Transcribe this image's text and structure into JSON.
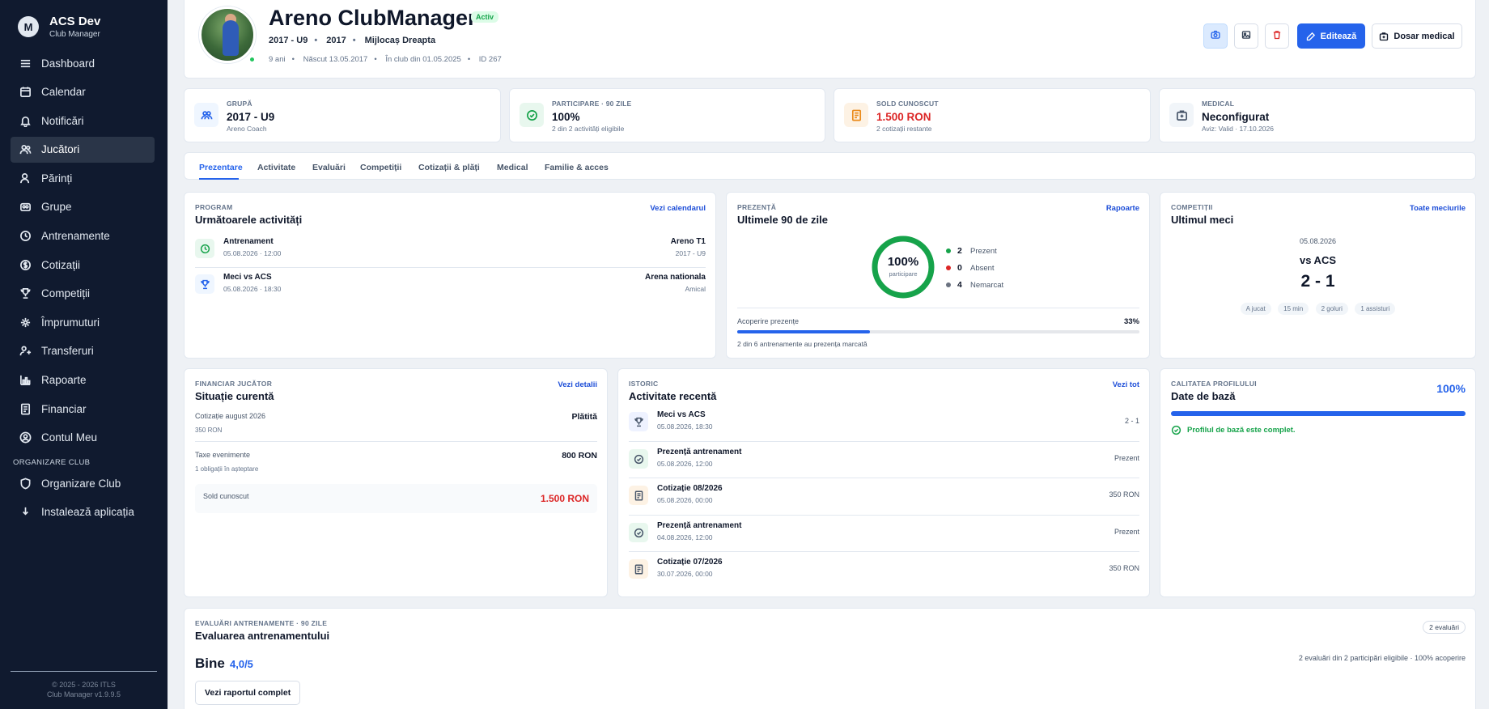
{
  "brand": {
    "title": "ACS Dev",
    "subtitle": "Club Manager",
    "logo_letter": "M"
  },
  "sidebar": {
    "items": [
      {
        "label": "Dashboard",
        "icon": "home-icon"
      },
      {
        "label": "Calendar",
        "icon": "calendar-icon"
      },
      {
        "label": "Notificări",
        "icon": "bell-icon"
      },
      {
        "label": "Jucători",
        "icon": "users-icon",
        "active": true
      },
      {
        "label": "Părinți",
        "icon": "user-icon"
      },
      {
        "label": "Grupe",
        "icon": "group-icon"
      },
      {
        "label": "Antrenamente",
        "icon": "whistle-icon"
      },
      {
        "label": "Cotizații",
        "icon": "dollar-icon"
      },
      {
        "label": "Competiții",
        "icon": "trophy-icon"
      },
      {
        "label": "Împrumuturi",
        "icon": "loan-icon"
      },
      {
        "label": "Transferuri",
        "icon": "transfer-icon"
      },
      {
        "label": "Rapoarte",
        "icon": "chart-icon"
      },
      {
        "label": "Financiar",
        "icon": "receipt-icon"
      },
      {
        "label": "Contul Meu",
        "icon": "account-icon"
      }
    ],
    "section_label": "ORGANIZARE CLUB",
    "section_items": [
      {
        "label": "Organizare Club",
        "icon": "shield-icon"
      },
      {
        "label": "Instalează aplicația",
        "icon": "download-icon"
      }
    ],
    "footer_line1": "© 2025 - 2026 ITLS",
    "footer_line2": "Club Manager v1.9.9.5"
  },
  "player": {
    "name": "Areno ClubManager",
    "status": "Activ",
    "group": "2017 - U9",
    "year": "2017",
    "position": "Mijlocaș Dreapta",
    "age": "9 ani",
    "born": "Născut 13.05.2017",
    "joined": "În club din 01.05.2025",
    "id": "ID 267"
  },
  "actions": {
    "edit": "Editează",
    "medical": "Dosar medical"
  },
  "stats": [
    {
      "label": "GRUPĂ",
      "value": "2017 - U9",
      "sub": "Areno Coach",
      "icon": "group-icon"
    },
    {
      "label": "PARTICIPARE · 90 ZILE",
      "value": "100%",
      "sub": "2 din 2 activități eligibile",
      "icon": "check-circle-icon"
    },
    {
      "label": "SOLD CUNOSCUT",
      "value": "1.500 RON",
      "sub": "2 cotizații restante",
      "icon": "receipt-icon"
    },
    {
      "label": "MEDICAL",
      "value": "Neconfigurat",
      "sub": "Aviz: Valid · 17.10.2026",
      "icon": "medical-kit-icon"
    }
  ],
  "tabs": [
    "Prezentare",
    "Activitate",
    "Evaluări",
    "Competiții",
    "Cotizații & plăți",
    "Medical",
    "Familie & acces"
  ],
  "program": {
    "label": "PROGRAM",
    "title": "Următoarele activități",
    "link": "Vezi calendarul",
    "items": [
      {
        "title": "Antrenament",
        "date": "05.08.2026 · 12:00",
        "place": "Areno T1",
        "detail": "2017 - U9",
        "icon": "clock-icon"
      },
      {
        "title": "Meci vs ACS",
        "date": "05.08.2026 · 18:30",
        "place": "Arena nationala",
        "detail": "Amical",
        "icon": "trophy-icon"
      }
    ]
  },
  "attendance": {
    "label": "PREZENȚĂ",
    "title": "Ultimele 90 de zile",
    "link": "Rapoarte",
    "percent": "100%",
    "percent_value": 100,
    "percent_caption": "participare",
    "legend": [
      {
        "count": "2",
        "label": "Prezent",
        "color": "#16a34a"
      },
      {
        "count": "0",
        "label": "Absent",
        "color": "#dc2626"
      },
      {
        "count": "4",
        "label": "Nemarcat",
        "color": "#6b7280"
      }
    ],
    "coverage_label": "Acoperire prezențe",
    "coverage_value": "33%",
    "coverage_fraction": 0.33,
    "coverage_note": "2 din 6 antrenamente au prezența marcată"
  },
  "last_match": {
    "label": "COMPETIȚII",
    "title": "Ultimul meci",
    "link": "Toate meciurile",
    "date": "05.08.2026",
    "opponent": "vs ACS",
    "score": "2 - 1",
    "chips": [
      "A jucat",
      "15 min",
      "2 goluri",
      "1 assisturi"
    ]
  },
  "finance": {
    "label": "FINANCIAR JUCĂTOR",
    "title": "Situație curentă",
    "link": "Vezi detalii",
    "items": [
      {
        "name": "Cotizație august 2026",
        "sub": "350 RON",
        "value": "Plătită"
      },
      {
        "name": "Taxe evenimente",
        "sub": "1 obligații în așteptare",
        "value": "800 RON"
      }
    ],
    "balance_label": "Sold cunoscut",
    "balance_value": "1.500 RON"
  },
  "history": {
    "label": "ISTORIC",
    "title": "Activitate recentă",
    "link": "Vezi tot",
    "items": [
      {
        "title": "Meci vs ACS",
        "date": "05.08.2026, 18:30",
        "value": "2 - 1",
        "icon": "trophy-icon",
        "tone": "blue"
      },
      {
        "title": "Prezență antrenament",
        "date": "05.08.2026, 12:00",
        "value": "Prezent",
        "icon": "check-circle-icon",
        "tone": "green"
      },
      {
        "title": "Cotizație 08/2026",
        "date": "05.08.2026, 00:00",
        "value": "350 RON",
        "icon": "receipt-icon",
        "tone": "orange"
      },
      {
        "title": "Prezență antrenament",
        "date": "04.08.2026, 12:00",
        "value": "Prezent",
        "icon": "check-circle-icon",
        "tone": "green"
      },
      {
        "title": "Cotizație 07/2026",
        "date": "30.07.2026, 00:00",
        "value": "350 RON",
        "icon": "receipt-icon",
        "tone": "orange"
      }
    ]
  },
  "profile_quality": {
    "label": "CALITATEA PROFILULUI",
    "title": "Date de bază",
    "percent": "100%",
    "fraction": 1.0,
    "message": "Profilul de bază este complet."
  },
  "evaluation": {
    "label": "EVALUĂRI ANTRENAMENTE · 90 ZILE",
    "title": "Evaluarea antrenamentului",
    "badge": "2 evaluări",
    "rating_word": "Bine",
    "rating_value": "4,0/5",
    "summary": "2 evaluări din 2 participări eligibile · 100% acoperire",
    "button": "Vezi raportul complet"
  },
  "colors": {
    "accent": "#2563eb",
    "sidebar": "#101a2f",
    "danger": "#dc2626",
    "success": "#16a34a",
    "warning": "#ea8a1a"
  }
}
